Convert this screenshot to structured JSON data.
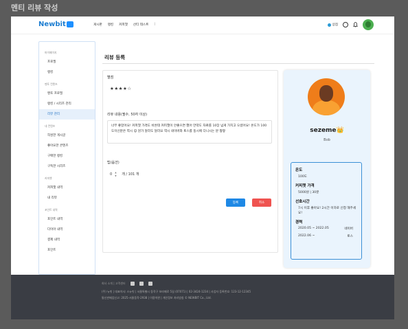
{
  "screen_title": "멘티 리뷰 작성",
  "header": {
    "logo": "Newbit",
    "nav": [
      "게시판",
      "랭킹",
      "커피챗",
      "산티 테스트",
      "|"
    ],
    "chip_label": "상점"
  },
  "sidebar": {
    "groups": [
      {
        "title": "마이페이지",
        "items": [
          "프로필",
          "랭킹"
        ]
      },
      {
        "title": "멘토 컨텐츠",
        "items": [
          "멘토 프로필",
          "랭킹 / 시리즈 관리",
          "리뷰 관리"
        ]
      },
      {
        "title": "내 컨텐츠",
        "items": [
          "작성한 게시글",
          "좋아요한 콘텐츠",
          "구매한 랭킹",
          "구독한 시리즈"
        ]
      },
      {
        "title": "커피챗",
        "items": [
          "커피챗 내역",
          "내 리뷰"
        ]
      },
      {
        "title": "포인트 내역",
        "items": [
          "포인트 내역",
          "다이아 내역",
          "결제 내역",
          "포인트"
        ]
      }
    ],
    "active": "리뷰 관리"
  },
  "page": {
    "title": "리뷰 등록",
    "rating_label": "별점",
    "rating_stars": "★★★★☆",
    "review_label": "리뷰 내용(필수, 50자 이상)",
    "review_text": "너무 좋았어요! 커피챗 가격도 비싼데 커피챗이 안좋으면 했어 만약도 자료를 10장 넘게 가지고 오셨어요! 온도가 100도이신분은 역시 😊 뭔가 달라도 달라요 역시 네이버와 토스를 동시에 다니시는 분 짱짱",
    "tip_label": "팁(옵션)",
    "tip_value": "0",
    "tip_suffix": "개 / 101 개",
    "submit_label": "등록",
    "cancel_label": "취소"
  },
  "profile": {
    "name": "sezeme👑",
    "sub": "Bob",
    "temp_label": "온도",
    "temp_value": "100도",
    "price_label": "커피챗 가격",
    "price_value": "5000원 | 30분",
    "pref_label": "선호시간",
    "pref_value": "7시 이후 좋아요! 2시간 이하로 신청 해주세요!",
    "career_label": "경력",
    "career": [
      {
        "period": "2020.05 ~ 2022.05",
        "company": "네이버"
      },
      {
        "period": "2022.06 ~",
        "company": "토스"
      }
    ]
  },
  "footer": {
    "top_links": "회사 소개  |  고객센터",
    "line1": "(주) 뉴빗  |  대표이사: 스뉴빗  |  서울특별시 동작구 보라매로 5길 (07071)  |  02-3424-1234  |  사업자 등록번호: 123-12-12345",
    "line2": "통신판매업신고: 2025-서울동작-2938  |  이용약관  |  개인정보 처리방침  © NEWBIT Co., Ltd."
  }
}
